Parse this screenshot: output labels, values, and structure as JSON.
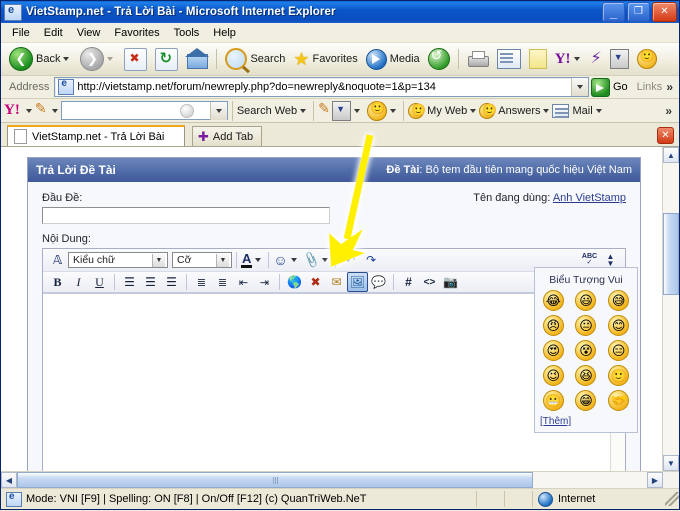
{
  "window": {
    "title": "VietStamp.net - Trả Lời Bài - Microsoft Internet Explorer",
    "minimize_label": "_",
    "maximize_label": "❐",
    "close_label": "✕"
  },
  "menu": {
    "items": [
      "File",
      "Edit",
      "View",
      "Favorites",
      "Tools",
      "Help"
    ]
  },
  "toolbar": {
    "back_label": "Back",
    "search_label": "Search",
    "favorites_label": "Favorites",
    "media_label": "Media",
    "icons": [
      "back-icon",
      "forward-icon",
      "stop-icon",
      "refresh-icon",
      "home-icon",
      "search-icon",
      "favorites-star-icon",
      "media-icon",
      "history-icon",
      "print-icon",
      "edit-icon",
      "discuss-icon",
      "yahoo-icon",
      "messenger-icon",
      "download-icon",
      "yahoo-smiley-icon"
    ]
  },
  "address": {
    "label": "Address",
    "url": "http://vietstamp.net/forum/newreply.php?do=newreply&noquote=1&p=134",
    "go_label": "Go",
    "links_label": "Links",
    "chevrons": "»"
  },
  "yahoo_toolbar": {
    "logo": "Y!",
    "search_placeholder": "",
    "search_web_label": "Search Web",
    "my_web_label": "My Web",
    "answers_label": "Answers",
    "mail_label": "Mail",
    "chevrons": "»"
  },
  "tabs": {
    "active_tab_label": "VietStamp.net - Trả Lời Bài",
    "add_tab_label": "Add Tab",
    "close_label": "✕"
  },
  "page": {
    "panel_title": "Trả Lời Đề Tài",
    "thread_prefix": "Đề Tài",
    "thread_title": "Bộ tem đầu tiên mang quốc hiệu Việt Nam",
    "subject_label": "Đầu Đề:",
    "subject_value": "",
    "username_label": "Tên đang dùng:",
    "username": "Anh VietStamp",
    "message_label": "Nội Dung:",
    "message_value": ""
  },
  "editor": {
    "font_select": "Kiểu chữ",
    "size_select": "Cỡ",
    "row1_icons": [
      "font-style-icon",
      "font-color-icon",
      "smiley-insert-icon",
      "attachment-icon",
      "undo-icon",
      "redo-icon",
      "spellcheck-icon",
      "toggle-size-icon"
    ],
    "row2_icons": [
      "bold-icon",
      "italic-icon",
      "underline-icon",
      "align-left-icon",
      "align-center-icon",
      "align-right-icon",
      "ordered-list-icon",
      "unordered-list-icon",
      "outdent-icon",
      "indent-icon",
      "insert-link-icon",
      "remove-link-icon",
      "insert-email-icon",
      "insert-image-icon",
      "insert-quote-icon",
      "insert-code-icon",
      "insert-html-icon",
      "insert-video-icon"
    ],
    "bold_label": "B",
    "italic_label": "I",
    "underline_label": "U",
    "code_label": "#",
    "html_label": "<>",
    "active_button": "insert-image-icon"
  },
  "smilies": {
    "title": "Biểu Tượng Vui",
    "more_label": "[Thêm]",
    "glyphs": [
      "😂",
      "😃",
      "😅",
      "😠",
      "😐",
      "😊",
      "😍",
      "😵",
      "😑",
      "😉",
      "😆",
      "🙂",
      "😬",
      "😁",
      "🤝"
    ]
  },
  "status": {
    "text": "Mode: VNI [F9] | Spelling: ON [F8] | On/Off [F12] (c) QuanTriWeb.NeT",
    "zone": "Internet"
  },
  "annotation": {
    "type": "arrow",
    "color": "#FFF000",
    "points_to": "insert-image-icon"
  },
  "colors": {
    "titlebar_blue": "#0b55c8",
    "panel_header_blue": "#4e6aa6",
    "link_blue": "#2b3c8f",
    "arrow_yellow": "#FFF000",
    "tab_accent_orange": "#f0a81e"
  }
}
